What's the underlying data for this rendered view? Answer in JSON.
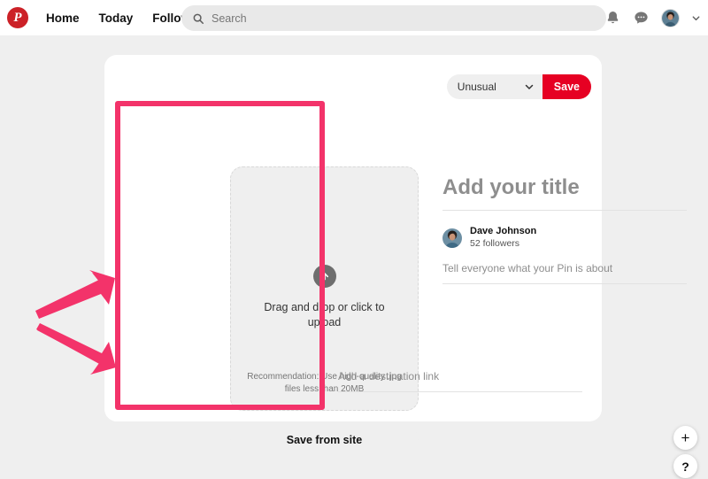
{
  "header": {
    "logo_icon": "pinterest-logo-icon",
    "logo_glyph": "P",
    "nav": [
      {
        "label": "Home"
      },
      {
        "label": "Today"
      },
      {
        "label": "Following"
      }
    ],
    "search": {
      "icon": "search-icon",
      "placeholder": "Search",
      "value": ""
    },
    "icons": [
      {
        "name": "notifications-bell-icon"
      },
      {
        "name": "messages-chat-icon"
      },
      {
        "name": "profile-avatar"
      },
      {
        "name": "chevron-down-icon"
      }
    ]
  },
  "editor": {
    "board": {
      "selected": "Unusual",
      "chevron_icon": "chevron-down-icon"
    },
    "save_label": "Save",
    "upload": {
      "icon": "upload-arrow-up-icon",
      "prompt": "Drag and drop or click to upload",
      "recommendation": "Recommendation: Use high-quality .jpg files less than 20MB",
      "save_from_site_label": "Save from site"
    },
    "title_placeholder": "Add your title",
    "user": {
      "avatar_icon": "user-avatar",
      "name": "Dave Johnson",
      "followers": "52 followers"
    },
    "description_placeholder": "Tell everyone what your Pin is about",
    "destination_link_placeholder": "Add a destination link"
  },
  "fabs": [
    {
      "name": "create-button",
      "glyph": "+"
    },
    {
      "name": "help-button",
      "glyph": "?"
    }
  ],
  "annotations": {
    "highlight_color": "#f3336a",
    "arrow_color": "#f3336a",
    "arrow_count": 2
  },
  "colors": {
    "brand_red": "#e60023",
    "logo_red": "#cc2127",
    "page_bg": "#efefef",
    "card_bg": "#ffffff",
    "annotation_pink": "#f3336a"
  }
}
